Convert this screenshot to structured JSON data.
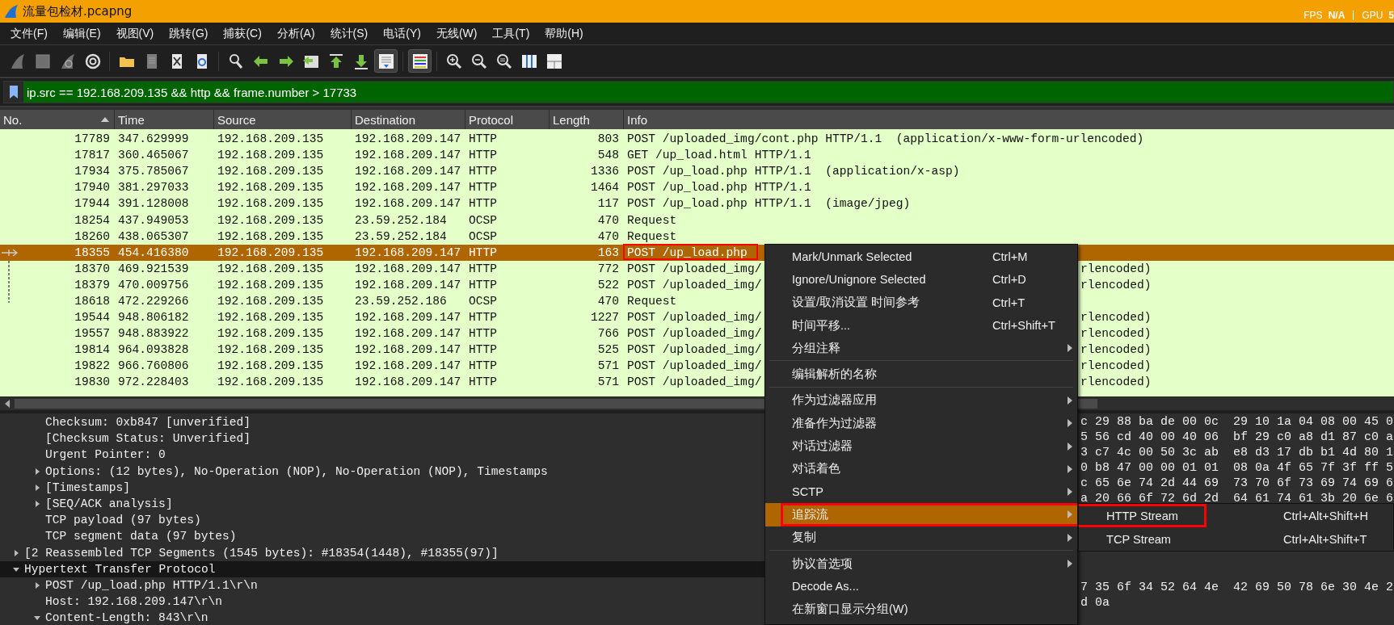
{
  "window": {
    "title": "流量包检材.pcapng",
    "overlay": {
      "fps_label": "FPS",
      "fps_value": "N/A",
      "gpu_label": "GPU",
      "gpu_value": "5"
    }
  },
  "menu_bar": [
    "文件(F)",
    "编辑(E)",
    "视图(V)",
    "跳转(G)",
    "捕获(C)",
    "分析(A)",
    "统计(S)",
    "电话(Y)",
    "无线(W)",
    "工具(T)",
    "帮助(H)"
  ],
  "toolbar": [
    {
      "kind": "fin",
      "on": false,
      "disabled": true
    },
    {
      "kind": "stop",
      "on": false,
      "disabled": true
    },
    {
      "kind": "restart",
      "on": false,
      "disabled": true
    },
    {
      "kind": "options",
      "on": false,
      "disabled": false
    },
    {
      "kind": "sep"
    },
    {
      "kind": "open",
      "on": false,
      "disabled": false
    },
    {
      "kind": "file",
      "on": false,
      "disabled": true
    },
    {
      "kind": "close-file",
      "on": false,
      "disabled": false
    },
    {
      "kind": "reload",
      "on": false,
      "disabled": false
    },
    {
      "kind": "sep"
    },
    {
      "kind": "find",
      "on": false,
      "disabled": false
    },
    {
      "kind": "back",
      "on": false,
      "disabled": false
    },
    {
      "kind": "forward",
      "on": false,
      "disabled": false
    },
    {
      "kind": "goto",
      "on": false,
      "disabled": false
    },
    {
      "kind": "first",
      "on": false,
      "disabled": false
    },
    {
      "kind": "last",
      "on": false,
      "disabled": false
    },
    {
      "kind": "autoscroll",
      "on": true,
      "disabled": false
    },
    {
      "kind": "sep"
    },
    {
      "kind": "colorize",
      "on": true,
      "disabled": false
    },
    {
      "kind": "sep"
    },
    {
      "kind": "zoom-in",
      "on": false,
      "disabled": false
    },
    {
      "kind": "zoom-out",
      "on": false,
      "disabled": false
    },
    {
      "kind": "zoom-reset",
      "on": false,
      "disabled": false
    },
    {
      "kind": "resize",
      "on": false,
      "disabled": false
    },
    {
      "kind": "layout",
      "on": false,
      "disabled": false
    }
  ],
  "filter": {
    "value": "ip.src == 192.168.209.135 && http && frame.number > 17733"
  },
  "columns": [
    {
      "label": "No.",
      "sorted": true
    },
    {
      "label": "Time",
      "sorted": false
    },
    {
      "label": "Source",
      "sorted": false
    },
    {
      "label": "Destination",
      "sorted": false
    },
    {
      "label": "Protocol",
      "sorted": false
    },
    {
      "label": "Length",
      "sorted": false
    },
    {
      "label": "Info",
      "sorted": false
    }
  ],
  "packets": [
    {
      "no": "17789",
      "time": "347.629999",
      "source": "192.168.209.135",
      "destination": "192.168.209.147",
      "protocol": "HTTP",
      "length": "803",
      "info": "POST /uploaded_img/cont.php HTTP/1.1  (application/x-www-form-urlencoded)",
      "selected": false
    },
    {
      "no": "17817",
      "time": "360.465067",
      "source": "192.168.209.135",
      "destination": "192.168.209.147",
      "protocol": "HTTP",
      "length": "548",
      "info": "GET /up_load.html HTTP/1.1",
      "selected": false
    },
    {
      "no": "17934",
      "time": "375.785067",
      "source": "192.168.209.135",
      "destination": "192.168.209.147",
      "protocol": "HTTP",
      "length": "1336",
      "info": "POST /up_load.php HTTP/1.1  (application/x-asp)",
      "selected": false
    },
    {
      "no": "17940",
      "time": "381.297033",
      "source": "192.168.209.135",
      "destination": "192.168.209.147",
      "protocol": "HTTP",
      "length": "1464",
      "info": "POST /up_load.php HTTP/1.1",
      "selected": false
    },
    {
      "no": "17944",
      "time": "391.128008",
      "source": "192.168.209.135",
      "destination": "192.168.209.147",
      "protocol": "HTTP",
      "length": "117",
      "info": "POST /up_load.php HTTP/1.1  (image/jpeg)",
      "selected": false
    },
    {
      "no": "18254",
      "time": "437.949053",
      "source": "192.168.209.135",
      "destination": "23.59.252.184",
      "protocol": "OCSP",
      "length": "470",
      "info": "Request",
      "selected": false
    },
    {
      "no": "18260",
      "time": "438.065307",
      "source": "192.168.209.135",
      "destination": "23.59.252.184",
      "protocol": "OCSP",
      "length": "470",
      "info": "Request",
      "selected": false
    },
    {
      "no": "18355",
      "time": "454.416380",
      "source": "192.168.209.135",
      "destination": "192.168.209.147",
      "protocol": "HTTP",
      "length": "163",
      "info": "POST /up_load.php",
      "selected": true,
      "related_arrow": true,
      "annotated": true
    },
    {
      "no": "18370",
      "time": "469.921539",
      "source": "192.168.209.135",
      "destination": "192.168.209.147",
      "protocol": "HTTP",
      "length": "772",
      "info": "POST /uploaded_img/",
      "info_tail": "rlencoded)",
      "selected": false,
      "related_line": true
    },
    {
      "no": "18379",
      "time": "470.009756",
      "source": "192.168.209.135",
      "destination": "192.168.209.147",
      "protocol": "HTTP",
      "length": "522",
      "info": "POST /uploaded_img/",
      "info_tail": "rlencoded)",
      "selected": false,
      "related_line": true
    },
    {
      "no": "18618",
      "time": "472.229266",
      "source": "192.168.209.135",
      "destination": "23.59.252.186",
      "protocol": "OCSP",
      "length": "470",
      "info": "Request",
      "selected": false,
      "related_line_end": true
    },
    {
      "no": "19544",
      "time": "948.806182",
      "source": "192.168.209.135",
      "destination": "192.168.209.147",
      "protocol": "HTTP",
      "length": "1227",
      "info": "POST /uploaded_img/",
      "info_tail": "rlencoded)",
      "selected": false
    },
    {
      "no": "19557",
      "time": "948.883922",
      "source": "192.168.209.135",
      "destination": "192.168.209.147",
      "protocol": "HTTP",
      "length": "766",
      "info": "POST /uploaded_img/",
      "info_tail": "rlencoded)",
      "selected": false
    },
    {
      "no": "19814",
      "time": "964.093828",
      "source": "192.168.209.135",
      "destination": "192.168.209.147",
      "protocol": "HTTP",
      "length": "525",
      "info": "POST /uploaded_img/",
      "info_tail": "rlencoded)",
      "selected": false
    },
    {
      "no": "19822",
      "time": "966.760806",
      "source": "192.168.209.135",
      "destination": "192.168.209.147",
      "protocol": "HTTP",
      "length": "571",
      "info": "POST /uploaded_img/",
      "info_tail": "rlencoded)",
      "selected": false
    },
    {
      "no": "19830",
      "time": "972.228403",
      "source": "192.168.209.135",
      "destination": "192.168.209.147",
      "protocol": "HTTP",
      "length": "571",
      "info": "POST /uploaded_img/",
      "info_tail": "rlencoded)",
      "selected": false
    }
  ],
  "details": {
    "tcp_fields": [
      {
        "text": "Checksum: 0xb847 [unverified]",
        "selected": false
      },
      {
        "text": "[Checksum Status: Unverified]",
        "selected": false
      },
      {
        "text": "Urgent Pointer: 0",
        "selected": false
      },
      {
        "text": "Options: (12 bytes), No-Operation (NOP), No-Operation (NOP), Timestamps",
        "expanded": false,
        "selected": false
      },
      {
        "text": "[Timestamps]",
        "expanded": false,
        "selected": false
      },
      {
        "text": "[SEQ/ACK analysis]",
        "expanded": false,
        "selected": false
      },
      {
        "text": "TCP payload (97 bytes)",
        "selected": false
      },
      {
        "text": "TCP segment data (97 bytes)",
        "selected": false
      }
    ],
    "layers": [
      {
        "text": "[2 Reassembled TCP Segments (1545 bytes): #18354(1448), #18355(97)]",
        "expanded": false,
        "selected": false
      },
      {
        "text": "Hypertext Transfer Protocol",
        "expanded": true,
        "selected": true,
        "children": [
          {
            "text": "POST /up_load.php HTTP/1.1\\r\\n",
            "expanded": false,
            "selected": false
          },
          {
            "text": "Host: 192.168.209.147\\r\\n",
            "selected": false
          },
          {
            "text": "Content-Length: 843\\r\\n",
            "expanded": true,
            "selected": false
          }
        ]
      }
    ]
  },
  "hex": {
    "rows_above_menu": [
      "c 29 88 ba de 00 0c  29 10 1a 04 08 00 45 0",
      "5 56 cd 40 00 40 06  bf 29 c0 a8 d1 87 c0 a",
      "3 c7 4c 00 50 3c ab  e8 d3 17 db b1 4d 80 1",
      "0 b8 47 00 00 01 01  08 0a 4f 65 7f 3f ff 5",
      "c 65 6e 74 2d 44 69  73 70 6f 73 69 74 69 6",
      "a 20 66 6f 72 6d 2d  64 61 74 61 3b 20 6e 6"
    ],
    "rows_below_menu": [
      "7 35 6f 34 52 64 4e  42 69 50 78 6e 30 4e 2",
      "d 0a"
    ]
  },
  "context_menu": [
    {
      "kind": "item",
      "label": "Mark/Unmark Selected",
      "shortcut": "Ctrl+M",
      "submenu": false,
      "selected": false
    },
    {
      "kind": "item",
      "label": "Ignore/Unignore Selected",
      "shortcut": "Ctrl+D",
      "submenu": false,
      "selected": false
    },
    {
      "kind": "item",
      "label": "设置/取消设置 时间参考",
      "shortcut": "Ctrl+T",
      "submenu": false,
      "selected": false
    },
    {
      "kind": "item",
      "label": "时间平移...",
      "shortcut": "Ctrl+Shift+T",
      "submenu": false,
      "selected": false
    },
    {
      "kind": "item",
      "label": "分组注释",
      "submenu": true,
      "selected": false
    },
    {
      "kind": "separator"
    },
    {
      "kind": "item",
      "label": "编辑解析的名称",
      "submenu": false,
      "selected": false
    },
    {
      "kind": "separator"
    },
    {
      "kind": "item",
      "label": "作为过滤器应用",
      "submenu": true,
      "selected": false
    },
    {
      "kind": "item",
      "label": "准备作为过滤器",
      "submenu": true,
      "selected": false
    },
    {
      "kind": "item",
      "label": "对话过滤器",
      "submenu": true,
      "selected": false
    },
    {
      "kind": "item",
      "label": "对话着色",
      "submenu": true,
      "selected": false
    },
    {
      "kind": "item",
      "label": "SCTP",
      "submenu": true,
      "selected": false
    },
    {
      "kind": "item",
      "label": "追踪流",
      "submenu": true,
      "selected": true,
      "annotated": true
    },
    {
      "kind": "item",
      "label": "复制",
      "submenu": true,
      "selected": false
    },
    {
      "kind": "separator"
    },
    {
      "kind": "item",
      "label": "协议首选项",
      "submenu": true,
      "selected": false
    },
    {
      "kind": "item",
      "label": "Decode As...",
      "submenu": false,
      "selected": false
    },
    {
      "kind": "item",
      "label": "在新窗口显示分组(W)",
      "submenu": false,
      "selected": false
    }
  ],
  "submenu": [
    {
      "label": "HTTP Stream",
      "shortcut": "Ctrl+Alt+Shift+H",
      "selected": false,
      "annotated": true
    },
    {
      "label": "TCP Stream",
      "shortcut": "Ctrl+Alt+Shift+T",
      "selected": false
    }
  ]
}
